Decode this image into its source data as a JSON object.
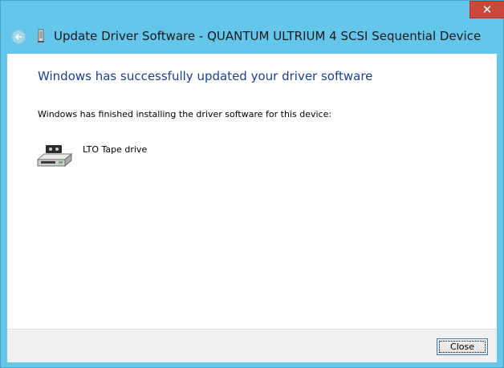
{
  "window": {
    "title": "Update Driver Software - QUANTUM ULTRIUM 4 SCSI Sequential Device",
    "close_glyph": "✕",
    "back_icon": "back-arrow-icon",
    "device_icon": "tape-device-icon"
  },
  "content": {
    "heading": "Windows has successfully updated your driver software",
    "subtext": "Windows has finished installing the driver software for this device:",
    "device": {
      "label": "LTO Tape drive",
      "icon": "tape-drive-icon"
    }
  },
  "footer": {
    "close_label_first": "C",
    "close_label_rest": "lose"
  },
  "colors": {
    "frame": "#63c6ea",
    "heading": "#1d3f9a",
    "close_button_bg": "#c9483a"
  }
}
